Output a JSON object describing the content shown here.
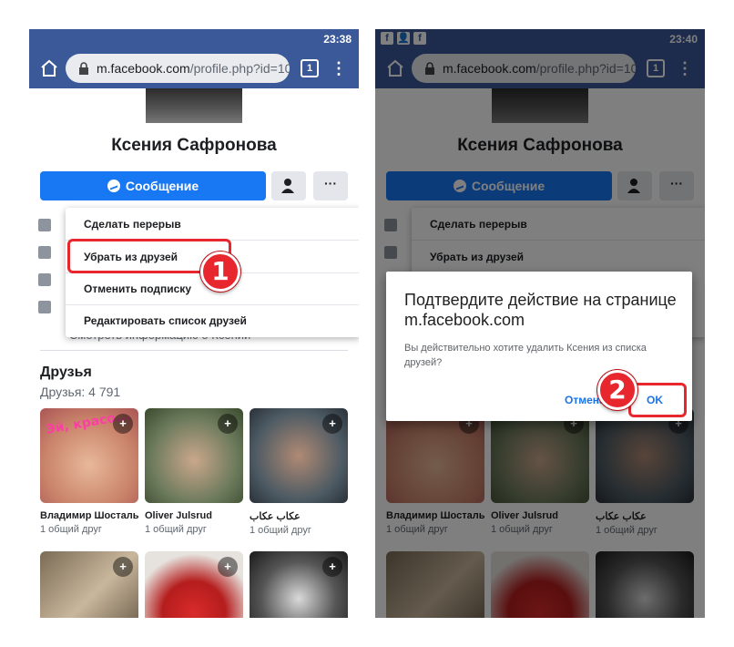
{
  "left_screen": {
    "status_time": "23:38",
    "url_host": "m.facebook.com",
    "url_path": "/profile.php?id=100",
    "tab_count": "1",
    "profile_name": "Ксения Сафронова",
    "message_button": "Сообщение",
    "more_button": "···",
    "friend_menu": [
      "Сделать перерыв",
      "Убрать из друзей",
      "Отменить подписку",
      "Редактировать список друзей"
    ],
    "more_info_text": "Смотреть информацию о Ксении",
    "friends_title": "Друзья",
    "friends_count": "Друзья: 4 791",
    "friends": [
      {
        "name": "Владимир Шосталь",
        "mutual": "1 общий друг",
        "photo_caption": "Эй, красо..."
      },
      {
        "name": "Oliver Julsrud",
        "mutual": "1 общий друг"
      },
      {
        "name": "عكاب عكاب",
        "mutual": "1 общий друг"
      }
    ],
    "step_number": "1"
  },
  "right_screen": {
    "status_time": "23:40",
    "notification_icons": [
      "f",
      "👤",
      "f"
    ],
    "url_host": "m.facebook.com",
    "url_path": "/profile.php?id=100",
    "tab_count": "1",
    "profile_name": "Ксения Сафронова",
    "message_button": "Сообщение",
    "more_button": "···",
    "friend_menu": [
      "Сделать перерыв",
      "Убрать из друзей"
    ],
    "dialog": {
      "title": "Подтвердите действие на странице m.facebook.com",
      "body": "Вы действительно хотите удалить Ксения из списка друзей?",
      "cancel": "Отмена",
      "ok": "OK"
    },
    "friends": [
      {
        "name": "Владимир Шосталь",
        "mutual": "1 общий друг"
      },
      {
        "name": "Oliver Julsrud",
        "mutual": "1 общий друг"
      },
      {
        "name": "عكاب عكاب",
        "mutual": "1 общий друг"
      }
    ],
    "step_number": "2"
  },
  "colors": {
    "facebook_blue": "#3b5998",
    "button_blue": "#1877f2",
    "highlight_red": "#e8262e",
    "dialog_link": "#1a73e8"
  }
}
